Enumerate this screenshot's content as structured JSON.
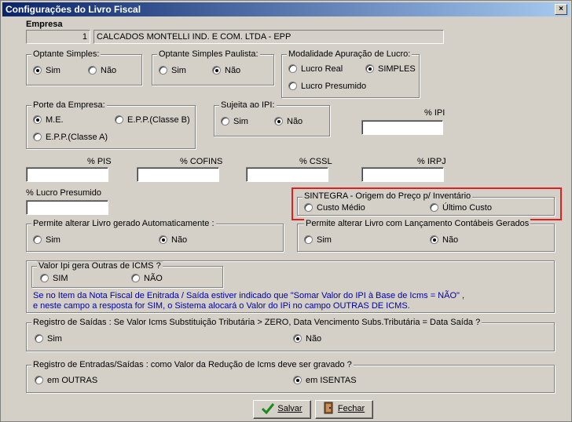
{
  "window": {
    "title": "Configurações do Livro Fiscal",
    "close_label": "×"
  },
  "empresa": {
    "label": "Empresa",
    "code": "1",
    "name": "CALCADOS MONTELLI IND. E COM. LTDA - EPP"
  },
  "optante_simples": {
    "legend": "Optante Simples:",
    "options": [
      "Sim",
      "Não"
    ],
    "selected": "Sim"
  },
  "optante_simples_paulista": {
    "legend": "Optante Simples Paulista:",
    "options": [
      "Sim",
      "Não"
    ],
    "selected": "Não"
  },
  "modalidade": {
    "legend": "Modalidade Apuração de Lucro:",
    "options": [
      "Lucro Real",
      "SIMPLES",
      "Lucro Presumido"
    ],
    "selected": "SIMPLES"
  },
  "porte": {
    "legend": "Porte da Empresa:",
    "options": [
      "M.E.",
      "E.P.P.(Classe B)",
      "E.P.P.(Classe A)"
    ],
    "selected": "M.E."
  },
  "sujeita_ipi": {
    "legend": "Sujeita ao IPI:",
    "options": [
      "Sim",
      "Não"
    ],
    "selected": "Não"
  },
  "fields": {
    "ipi": {
      "label": "% IPI",
      "value": ""
    },
    "pis": {
      "label": "% PIS",
      "value": ""
    },
    "cofins": {
      "label": "% COFINS",
      "value": ""
    },
    "cssl": {
      "label": "% CSSL",
      "value": ""
    },
    "irpj": {
      "label": "% IRPJ",
      "value": ""
    },
    "lucro_presumido": {
      "label": "% Lucro Presumido",
      "value": ""
    }
  },
  "sintegra": {
    "legend": "SINTEGRA - Origem do Preço p/ Inventário",
    "options": [
      "Custo Médio",
      "Último Custo"
    ],
    "selected": ""
  },
  "livro_auto": {
    "legend": "Permite alterar Livro gerado Automaticamente :",
    "options": [
      "Sim",
      "Não"
    ],
    "selected": "Não"
  },
  "livro_contabeis": {
    "legend": "Permite alterar Livro com Lançamento Contábeis Gerados",
    "options": [
      "Sim",
      "Não"
    ],
    "selected": "Não"
  },
  "valor_ipi": {
    "legend": "Valor Ipi gera Outras de ICMS ?",
    "options": [
      "SIM",
      "NÃO"
    ],
    "selected": "",
    "note_line1": "Se no Item da Nota Fiscal de Enitrada / Saída estiver indicado que \"Somar Valor do IPI à  Base de Icms  = NÃO\" ,",
    "note_line2": "e neste campo a resposta for SIM, o Sistema alocará o Valor do IPi no campo OUTRAS DE ICMS."
  },
  "registro_saidas": {
    "legend": "Registro de Saídas : Se Valor Icms Substituição Tributária > ZERO, Data Vencimento Subs.Tributária = Data Saída ?",
    "options": [
      "Sim",
      "Não"
    ],
    "selected": "Não"
  },
  "registro_entradas": {
    "legend": "Registro de Entradas/Saídas : como Valor da Redução de Icms deve ser gravado ?",
    "options": [
      "em OUTRAS",
      "em ISENTAS"
    ],
    "selected": "em ISENTAS"
  },
  "buttons": {
    "save": "Salvar",
    "close": "Fechar"
  },
  "icons": {
    "save": "check-icon",
    "close": "door-exit-icon"
  },
  "colors": {
    "title_start": "#0a246a",
    "title_end": "#a6caf0",
    "highlight": "#e02020",
    "note_text": "#0000a8"
  }
}
